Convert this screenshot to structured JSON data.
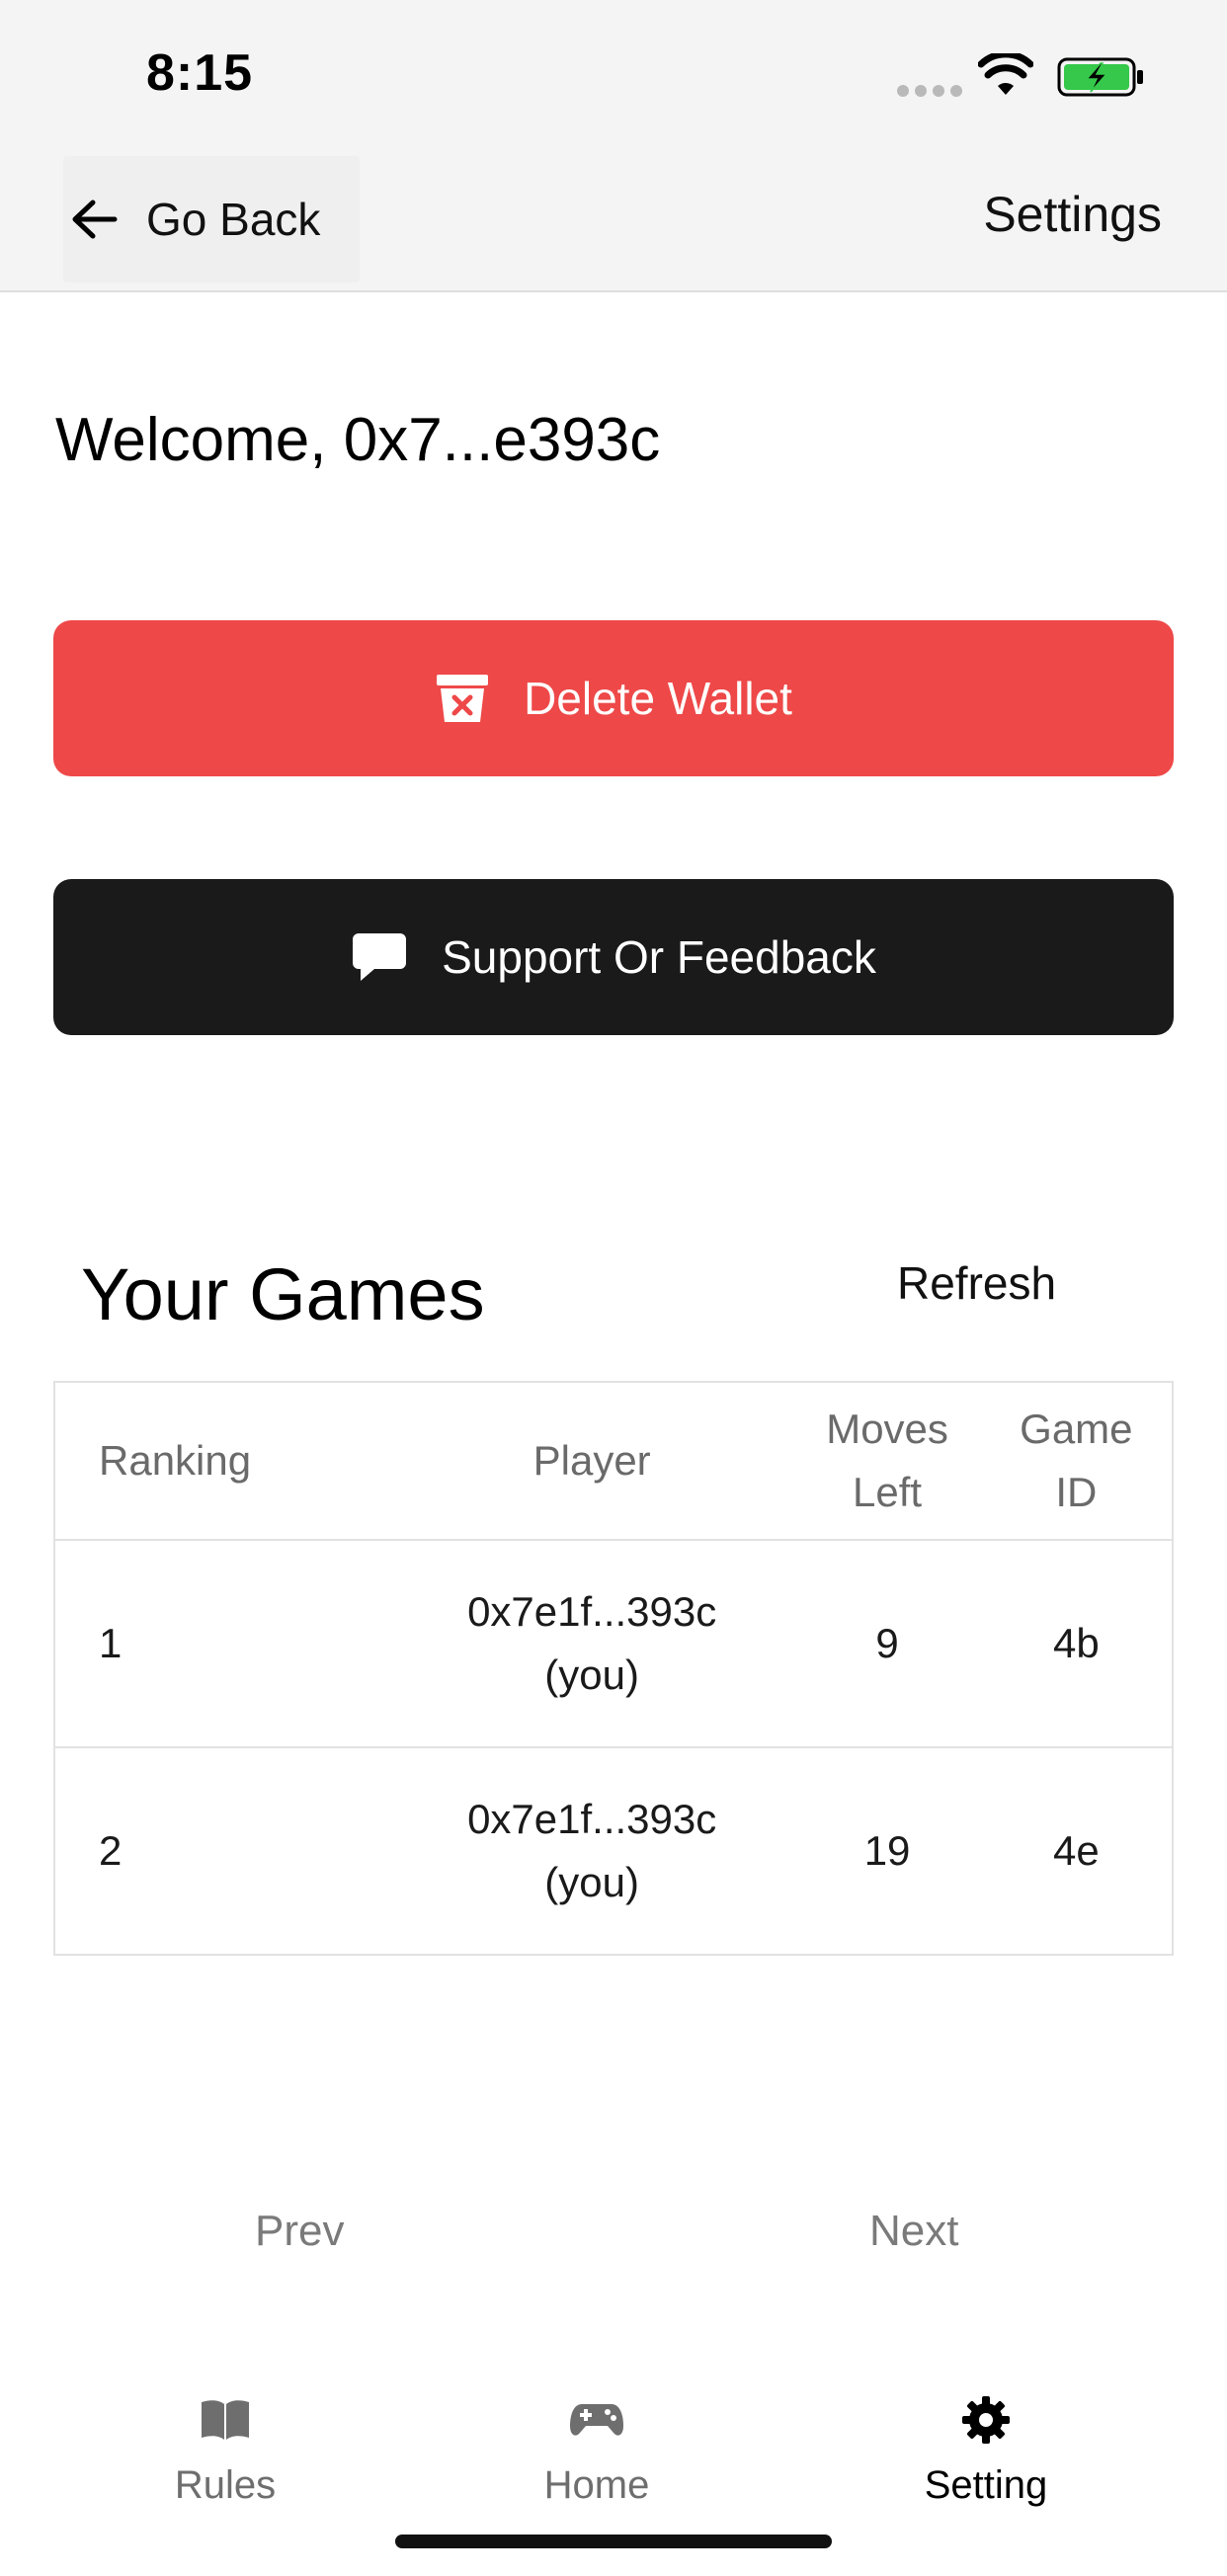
{
  "status_bar": {
    "time": "8:15",
    "icons": [
      "signal-dots-icon",
      "wifi-icon",
      "battery-charging-icon"
    ],
    "battery_color": "#35c84a"
  },
  "nav": {
    "back_label": "Go Back",
    "title": "Settings"
  },
  "welcome": "Welcome, 0x7...e393c",
  "buttons": {
    "delete_wallet": "Delete Wallet",
    "support": "Support Or Feedback"
  },
  "colors": {
    "delete": "#ee4848",
    "support": "#1a1a1a"
  },
  "games": {
    "title": "Your Games",
    "refresh_label": "Refresh",
    "columns": {
      "ranking": "Ranking",
      "player": "Player",
      "moves_line1": "Moves",
      "moves_line2": "Left",
      "game_line1": "Game",
      "game_line2": "ID"
    },
    "rows": [
      {
        "ranking": "1",
        "player": "0x7e1f...393c",
        "player_note": "(you)",
        "moves_left": "9",
        "game_id": "4b"
      },
      {
        "ranking": "2",
        "player": "0x7e1f...393c",
        "player_note": "(you)",
        "moves_left": "19",
        "game_id": "4e"
      }
    ]
  },
  "pagination": {
    "prev": "Prev",
    "next": "Next"
  },
  "tabs": [
    {
      "label": "Rules",
      "icon": "book-icon",
      "active": false
    },
    {
      "label": "Home",
      "icon": "gamepad-icon",
      "active": false
    },
    {
      "label": "Setting",
      "icon": "gear-icon",
      "active": true
    }
  ]
}
